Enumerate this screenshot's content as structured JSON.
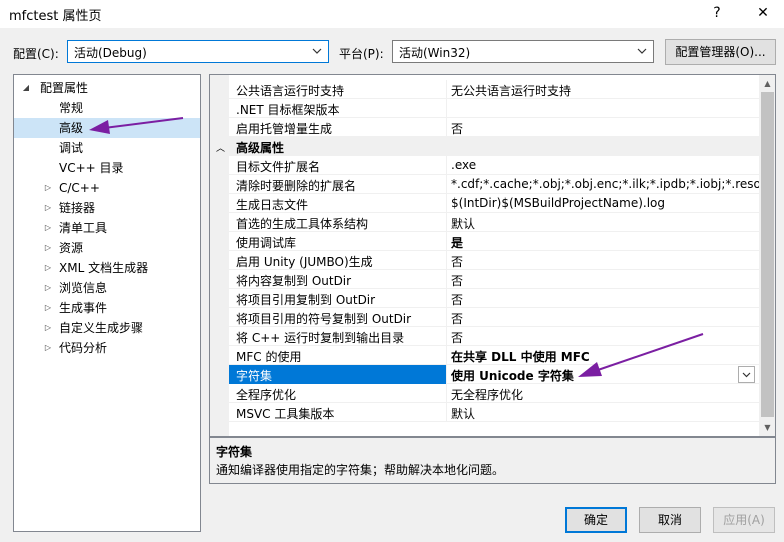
{
  "window": {
    "title": "mfctest 属性页",
    "help_label": "?",
    "close_label": "✕"
  },
  "config": {
    "label": "配置(C):",
    "value": "活动(Debug)",
    "platform_label": "平台(P):",
    "platform_value": "活动(Win32)",
    "manager_button": "配置管理器(O)..."
  },
  "tree": {
    "root": "配置属性",
    "items": [
      {
        "label": "常规",
        "expandable": false
      },
      {
        "label": "高级",
        "expandable": false,
        "selected": true
      },
      {
        "label": "调试",
        "expandable": false
      },
      {
        "label": "VC++ 目录",
        "expandable": false
      },
      {
        "label": "C/C++",
        "expandable": true
      },
      {
        "label": "链接器",
        "expandable": true
      },
      {
        "label": "清单工具",
        "expandable": true
      },
      {
        "label": "资源",
        "expandable": true
      },
      {
        "label": "XML 文档生成器",
        "expandable": true
      },
      {
        "label": "浏览信息",
        "expandable": true
      },
      {
        "label": "生成事件",
        "expandable": true
      },
      {
        "label": "自定义生成步骤",
        "expandable": true
      },
      {
        "label": "代码分析",
        "expandable": true
      }
    ]
  },
  "grid": {
    "rows": [
      {
        "name": "公共语言运行时支持",
        "value": "无公共语言运行时支持"
      },
      {
        "name": ".NET 目标框架版本",
        "value": ""
      },
      {
        "name": "启用托管增量生成",
        "value": "否"
      },
      {
        "name": "高级属性",
        "value": "",
        "category": true
      },
      {
        "name": "目标文件扩展名",
        "value": ".exe"
      },
      {
        "name": "清除时要删除的扩展名",
        "value": "*.cdf;*.cache;*.obj;*.obj.enc;*.ilk;*.ipdb;*.iobj;*.resources;"
      },
      {
        "name": "生成日志文件",
        "value": "$(IntDir)$(MSBuildProjectName).log"
      },
      {
        "name": "首选的生成工具体系结构",
        "value": "默认"
      },
      {
        "name": "使用调试库",
        "value": "是",
        "bold": true
      },
      {
        "name": "启用 Unity (JUMBO)生成",
        "value": "否"
      },
      {
        "name": "将内容复制到 OutDir",
        "value": "否"
      },
      {
        "name": "将项目引用复制到 OutDir",
        "value": "否"
      },
      {
        "name": "将项目引用的符号复制到 OutDir",
        "value": "否"
      },
      {
        "name": "将 C++ 运行时复制到输出目录",
        "value": "否"
      },
      {
        "name": "MFC 的使用",
        "value": "在共享 DLL 中使用 MFC",
        "bold": true
      },
      {
        "name": "字符集",
        "value": "使用 Unicode 字符集",
        "bold": true,
        "selected": true
      },
      {
        "name": "全程序优化",
        "value": "无全程序优化"
      },
      {
        "name": "MSVC 工具集版本",
        "value": "默认"
      }
    ]
  },
  "description": {
    "title": "字符集",
    "text": "通知编译器使用指定的字符集；帮助解决本地化问题。"
  },
  "buttons": {
    "ok": "确定",
    "cancel": "取消",
    "apply": "应用(A)"
  },
  "colors": {
    "accent": "#0078d7",
    "annotation_arrow": "#7b1fa2"
  }
}
